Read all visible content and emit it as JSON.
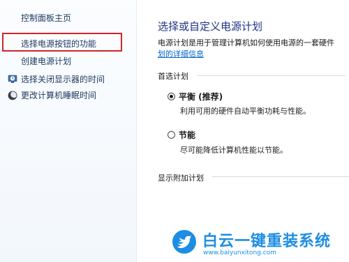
{
  "sidebar": {
    "home_label": "控制面板主页",
    "items": [
      {
        "label": "选择电源按钮的功能",
        "highlighted": true
      },
      {
        "label": "创建电源计划"
      },
      {
        "label": "选择关闭显示器的时间",
        "icon": "clock-monitor-icon"
      },
      {
        "label": "更改计算机睡眠时间",
        "icon": "moon-icon"
      }
    ]
  },
  "main": {
    "title": "选择或自定义电源计划",
    "description": "电源计划是用于管理计算机如何使用电源的一套硬件",
    "description_link": "划的详细信息",
    "preferred_section": "首选计划",
    "plans": [
      {
        "name": "平衡 (推荐)",
        "description": "利用可用的硬件自动平衡功耗与性能。",
        "selected": true
      },
      {
        "name": "节能",
        "description": "尽可能降低计算机性能以节能。",
        "selected": false
      }
    ],
    "additional_section": "显示附加计划"
  },
  "watermark": {
    "brand": "白云一键重装系统",
    "url": "www.baiyunxitong.com"
  },
  "colors": {
    "title_blue": "#1e3287",
    "link_blue": "#0066cc",
    "highlight_red": "#d0242a",
    "watermark_blue": "#1c8de3"
  }
}
